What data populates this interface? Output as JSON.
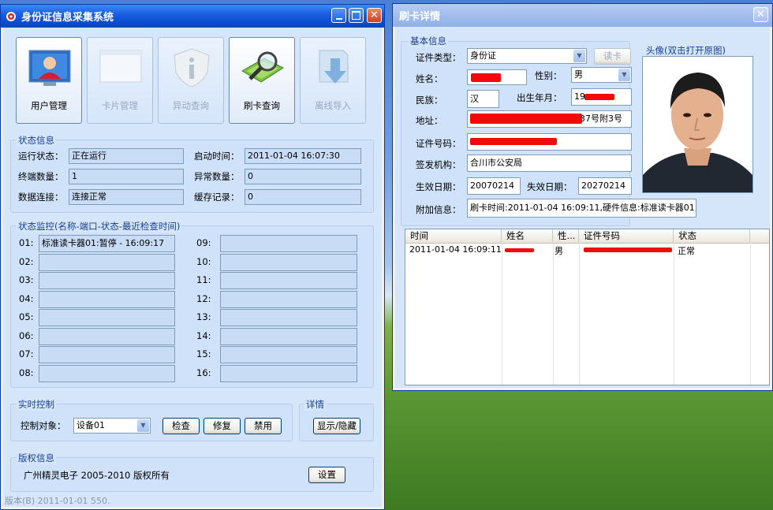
{
  "main_window": {
    "title": "身份证信息采集系统",
    "toolbar": [
      {
        "label": "用户管理",
        "icon": "user-icon",
        "enabled": true
      },
      {
        "label": "卡片管理",
        "icon": "card-window-icon",
        "enabled": false
      },
      {
        "label": "异动查询",
        "icon": "info-shield-icon",
        "enabled": false
      },
      {
        "label": "刷卡查询",
        "icon": "card-search-icon",
        "enabled": true
      },
      {
        "label": "离线导入",
        "icon": "import-arrow-icon",
        "enabled": false
      }
    ],
    "status": {
      "title": "状态信息",
      "run_state_label": "运行状态：",
      "run_state": "正在运行",
      "start_time_label": "启动时间：",
      "start_time": "2011-01-04 16:07:30",
      "terminal_count_label": "终端数量：",
      "terminal_count": "1",
      "error_count_label": "异常数量：",
      "error_count": "0",
      "db_conn_label": "数据连接：",
      "db_conn": "连接正常",
      "cache_label": "缓存记录：",
      "cache": "0"
    },
    "monitor": {
      "title": "状态监控(名称-端口-状态-最近检查时间)",
      "slots": [
        {
          "num": "01:",
          "value": "标准读卡器01:暂停 - 16:09:17"
        },
        {
          "num": "02:",
          "value": ""
        },
        {
          "num": "03:",
          "value": ""
        },
        {
          "num": "04:",
          "value": ""
        },
        {
          "num": "05:",
          "value": ""
        },
        {
          "num": "06:",
          "value": ""
        },
        {
          "num": "07:",
          "value": ""
        },
        {
          "num": "08:",
          "value": ""
        },
        {
          "num": "09:",
          "value": ""
        },
        {
          "num": "10:",
          "value": ""
        },
        {
          "num": "11:",
          "value": ""
        },
        {
          "num": "12:",
          "value": ""
        },
        {
          "num": "13:",
          "value": ""
        },
        {
          "num": "14:",
          "value": ""
        },
        {
          "num": "15:",
          "value": ""
        },
        {
          "num": "16:",
          "value": ""
        }
      ]
    },
    "control": {
      "title": "实时控制",
      "target_label": "控制对象：",
      "target_value": "设备01",
      "check_label": "检查",
      "repair_label": "修复",
      "disable_label": "禁用"
    },
    "detail": {
      "title": "详情",
      "toggle_label": "显示/隐藏"
    },
    "copyright": {
      "title": "版权信息",
      "text": "广州精灵电子 2005-2010 版权所有",
      "settings_label": "设置"
    },
    "version": "版本(B) 2011-01-01 550."
  },
  "detail_window": {
    "title": "刷卡详情",
    "basic": {
      "title": "基本信息",
      "id_type_label": "证件类型：",
      "id_type": "身份证",
      "read_card_label": "读卡",
      "name_label": "姓名：",
      "gender_label": "性别：",
      "gender": "男",
      "ethnicity_label": "民族：",
      "ethnicity": "汉",
      "birth_label": "出生年月：",
      "birth": "19",
      "address_label": "地址：",
      "address_tail": "37号附3号",
      "id_number_label": "证件号码：",
      "issuer_label": "签发机构：",
      "issuer": "合川市公安局",
      "valid_from_label": "生效日期：",
      "valid_from": "20070214",
      "valid_to_label": "失效日期：",
      "valid_to": "20270214",
      "extra_label": "附加信息：",
      "extra": "刷卡时间:2011-01-04 16:09:11,硬件信息:标准读卡器01,"
    },
    "photo_title": "头像(双击打开原图)",
    "table": {
      "columns": [
        "时间",
        "姓名",
        "性...",
        "证件号码",
        "状态"
      ],
      "rows": [
        {
          "time": "2011-01-04 16:09:11",
          "gender": "男",
          "status": "正常"
        }
      ]
    }
  },
  "colors": {
    "title_bar": "#0a44c0",
    "client_bg": "#d5e6fb",
    "redaction": "#f20a0a"
  }
}
